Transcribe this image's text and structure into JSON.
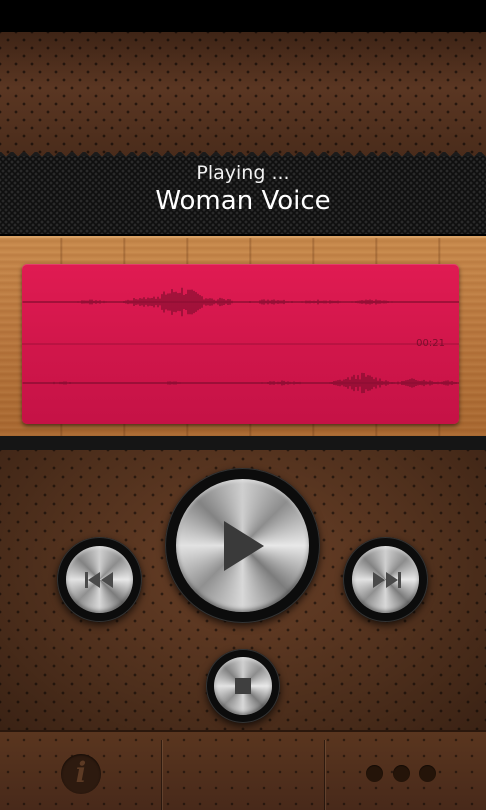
{
  "player": {
    "status": "Playing ...",
    "track_title": "Woman Voice",
    "duration": "00:21"
  },
  "controls": {
    "play_icon": "play-icon",
    "previous_icon": "skip-back-icon",
    "next_icon": "skip-forward-icon",
    "stop_icon": "stop-icon"
  },
  "app_bar": {
    "info_icon": "info-icon",
    "info_glyph": "i",
    "more_icon": "more-dots-icon"
  },
  "colors": {
    "waveform_card": "#d0164a",
    "waveform_trace": "#6b0a26"
  }
}
